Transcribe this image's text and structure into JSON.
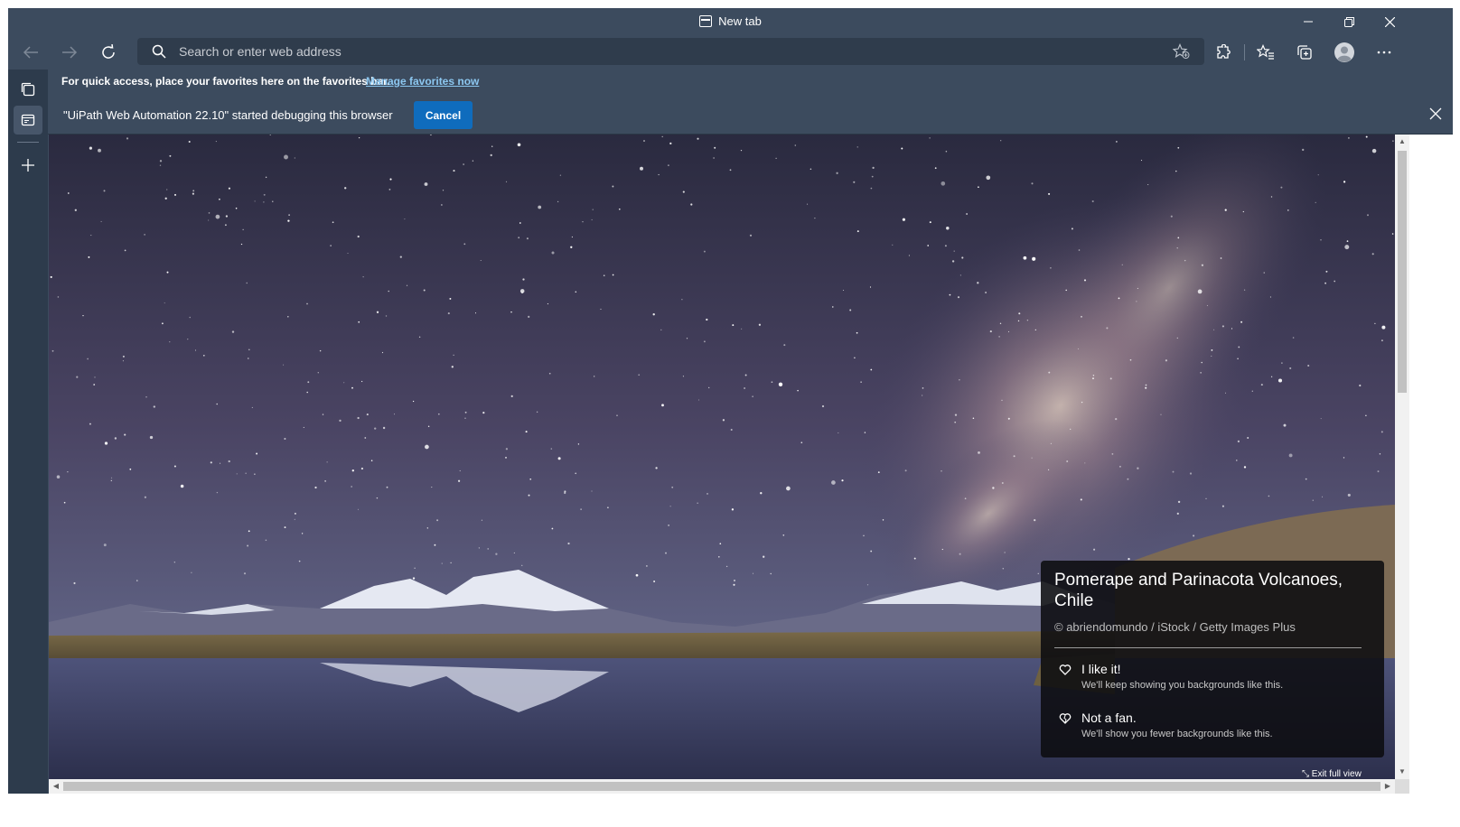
{
  "window": {
    "title": "New tab",
    "controls": [
      "minimize-icon",
      "restore-icon",
      "close-icon"
    ]
  },
  "toolbar": {
    "back_icon": "arrow-left-icon",
    "forward_icon": "arrow-right-icon",
    "refresh_icon": "refresh-icon",
    "search_placeholder": "Search or enter web address",
    "search_value": "",
    "right_icons": [
      "add-favorite-icon",
      "extensions-icon",
      "favorites-icon",
      "collections-icon",
      "profile-icon",
      "more-icon"
    ]
  },
  "sidebar": {
    "items": [
      "tab-actions-icon",
      "vertical-tabs-icon",
      "new-tab-icon"
    ]
  },
  "favorites_bar": {
    "message": "For quick access, place your favorites here on the favorites bar.",
    "link": "Manage favorites now"
  },
  "debug_bar": {
    "message": "\"UiPath Web Automation 22.10\" started debugging this browser",
    "cancel_label": "Cancel"
  },
  "background_card": {
    "title": "Pomerape and Parinacota Volcanoes, Chile",
    "credit": "© abriendomundo / iStock / Getty Images Plus",
    "like_label": "I like it!",
    "like_desc": "We'll keep showing you backgrounds like this.",
    "dislike_label": "Not a fan.",
    "dislike_desc": "We'll show you fewer backgrounds like this."
  },
  "exit_full_view": "Exit full view",
  "colors": {
    "chrome": "#3c4b5e",
    "sidebar": "#2d3b4c",
    "accent": "#0f6cbd",
    "link": "#8cc7f0"
  }
}
